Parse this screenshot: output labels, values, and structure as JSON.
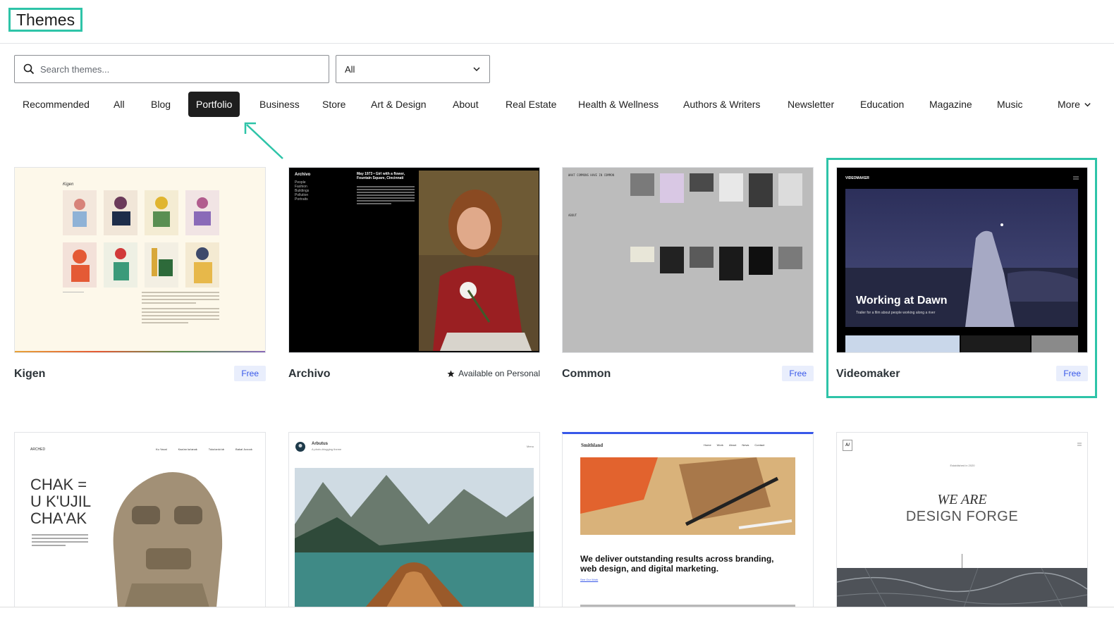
{
  "header": {
    "title": "Themes"
  },
  "search": {
    "placeholder": "Search themes..."
  },
  "filter": {
    "selected": "All"
  },
  "categories": [
    {
      "label": "Recommended"
    },
    {
      "label": "All"
    },
    {
      "label": "Blog"
    },
    {
      "label": "Portfolio",
      "active": true
    },
    {
      "label": "Business"
    },
    {
      "label": "Store"
    },
    {
      "label": "Art & Design"
    },
    {
      "label": "About"
    },
    {
      "label": "Real Estate"
    },
    {
      "label": "Health & Wellness"
    },
    {
      "label": "Authors & Writers"
    },
    {
      "label": "Newsletter"
    },
    {
      "label": "Education"
    },
    {
      "label": "Magazine"
    },
    {
      "label": "Music"
    },
    {
      "label": "More"
    }
  ],
  "themes": [
    {
      "name": "Kigen",
      "badge": "Free"
    },
    {
      "name": "Archivo",
      "availability": "Available on Personal"
    },
    {
      "name": "Common",
      "badge": "Free"
    },
    {
      "name": "Videomaker",
      "badge": "Free"
    },
    {
      "name": "Arched"
    },
    {
      "name": "Arbutus"
    },
    {
      "name": "Smithland"
    },
    {
      "name": "Design Forge"
    }
  ],
  "previews": {
    "kigen": {
      "heading": "Kigen"
    },
    "archivo": {
      "brand": "Archivo",
      "headline": "May 1973 • Girl with a flower, Fountain Square, Cincinnati",
      "nav": [
        "People",
        "Fashion",
        "Buildings",
        "Pollution",
        "Portraits"
      ]
    },
    "common": {
      "intro": "WHAT COMMONS HAVE IN COMMON",
      "label": "ABOUT"
    },
    "videomaker": {
      "brand": "VIDEOMAKER",
      "headline": "Working at Dawn",
      "sub": "Trailer for a film about people working along a river"
    },
    "arched": {
      "brand": "ARCHED",
      "headline": "CHAK = U K'UJIL CHA'AK",
      "nav": [
        "Ku Yaxal",
        "Kaa'an ka'anak",
        "Tuka'anlo'ob",
        "Bakal Juxook"
      ]
    },
    "arbutus": {
      "brand": "Arbutus",
      "tagline": "A photo-blogging theme",
      "menu": "Menu"
    },
    "smithland": {
      "brand": "Smithland",
      "nav": [
        "Home",
        "Work",
        "About",
        "News",
        "Contact"
      ],
      "headline": "We deliver outstanding results across branding, web design, and digital marketing.",
      "link": "See Our Work"
    },
    "designforge": {
      "logo": "A/",
      "eyebrow": "Established in 2020",
      "headline1": "WE ARE",
      "headline2": "DESIGN FORGE"
    }
  },
  "colors": {
    "accent": "#2ec4a8",
    "active_tab": "#1e1e1e",
    "badge_bg": "#e9eefc",
    "badge_text": "#3858e9"
  }
}
